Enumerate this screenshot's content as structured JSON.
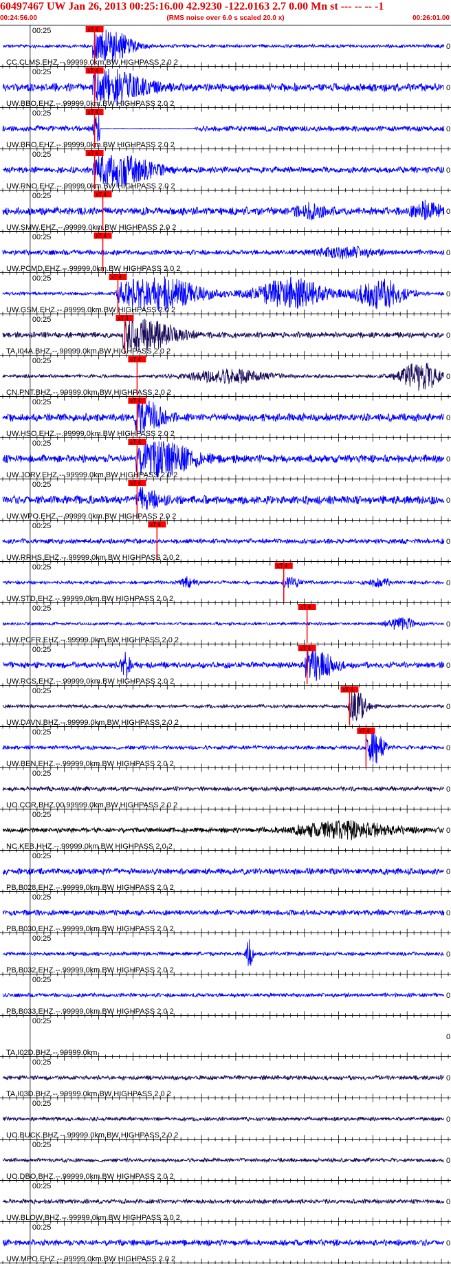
{
  "header": {
    "title": "60497467 UW Jan 26, 2013 00:25:16.00   42.9230 -122.0163  2.7 0.00 Mn st --- -- --  -1",
    "start_time": "00:24:56.00",
    "note": "(RMS noise over 6.0 s scaled 20.0 x)",
    "end_time": "00:26:01.00"
  },
  "chart_data": {
    "type": "line",
    "title": "60497467 UW Jan 26, 2013 00:25:16.00   42.9230 -122.0163  2.7 0.00 Mn st --- -- --  -1",
    "x_start": "00:24:56.00",
    "x_end": "00:26:01.00",
    "x_range_seconds": [
      0,
      65
    ],
    "minute_marker": "00:25",
    "minute_marker_seconds": 4,
    "pick_label": "xT 4",
    "edge_mark": "0",
    "colors": {
      "blue": "#0000ff",
      "navy": "#1a0a5a",
      "black": "#000000",
      "pick": "#ff0000"
    },
    "traces": [
      {
        "label": "CC.CLMS.EHZ.--.99999.0km.BW  HIGHPASS  2.0  2",
        "color": "#0000ff",
        "pick_s": 13.4,
        "noise": 0.12,
        "bursts": [
          [
            15.2,
            2.5,
            1.1
          ]
        ]
      },
      {
        "label": "UW.BBO.EHZ.--.99999.0km.BW  HIGHPASS  2.0  2",
        "color": "#0000ff",
        "pick_s": 13.4,
        "noise": 0.28,
        "bursts": [
          [
            16.0,
            3.5,
            1.0
          ]
        ]
      },
      {
        "label": "UW.BRO.EHZ.--.99999.0km.BW  HIGHPASS  2.0  2",
        "color": "#0000ff",
        "pick_s": 13.4,
        "noise": 0.2,
        "bursts": [
          [
            13.8,
            0.4,
            1.0
          ]
        ],
        "flat": [
          14.2,
          28
        ]
      },
      {
        "label": "UW.RNO.EHZ.--.99999.0km.BW  HIGHPASS  2.0  2",
        "color": "#0000ff",
        "pick_s": 13.4,
        "noise": 0.22,
        "bursts": [
          [
            16.5,
            3.5,
            1.1
          ]
        ]
      },
      {
        "label": "UW.SMW.EHZ.--.99999.0km.BW  HIGHPASS  2.0  2",
        "color": "#0000ff",
        "pick_s": 14.6,
        "noise": 0.28,
        "bursts": [
          [
            62,
            1.5,
            0.5
          ],
          [
            45,
            1.5,
            0.35
          ]
        ]
      },
      {
        "label": "UW.PCMD.EHZ.--.99999.0km.BW  HIGHPASS  2.0  2",
        "color": "#0000ff",
        "pick_s": 14.6,
        "noise": 0.18,
        "bursts": [
          [
            50,
            3,
            0.3
          ]
        ]
      },
      {
        "label": "UW.GSM.EHZ.--.99999.0km.BW  HIGHPASS  2.0  2",
        "color": "#0000ff",
        "pick_s": 16.8,
        "noise": 0.12,
        "bursts": [
          [
            22,
            5,
            1.1
          ],
          [
            42,
            3.5,
            1.0
          ],
          [
            55,
            2.5,
            1.0
          ]
        ]
      },
      {
        "label": "TA.I04A.BHZ.--.99999.0km.BW  HIGHPASS  2.0  2",
        "color": "#1a0a5a",
        "pick_s": 17.8,
        "noise": 0.2,
        "bursts": [
          [
            20,
            4,
            0.95
          ]
        ]
      },
      {
        "label": "CN.PNT.BHZ.--.99999.0km.BW  HIGHPASS  2.0  2",
        "color": "#1a0a5a",
        "pick_s": 19.6,
        "noise": 0.12,
        "bursts": [
          [
            33,
            4,
            0.45
          ],
          [
            61,
            2,
            0.95
          ]
        ]
      },
      {
        "label": "UW.HSO.EHZ.--.99999.0km.BW  HIGHPASS  2.0  2",
        "color": "#0000ff",
        "pick_s": 19.6,
        "noise": 0.28,
        "bursts": [
          [
            20.8,
            1.8,
            1.0
          ]
        ]
      },
      {
        "label": "UW.JORV.EHZ.--.99999.0km.BW  HIGHPASS  2.0  2",
        "color": "#0000ff",
        "pick_s": 19.6,
        "noise": 0.28,
        "bursts": [
          [
            22.5,
            3.5,
            1.1
          ]
        ]
      },
      {
        "label": "UW.WPO.EHZ.--.99999.0km.BW  HIGHPASS  2.0  2",
        "color": "#0000ff",
        "pick_s": 19.6,
        "noise": 0.3,
        "bursts": [
          [
            20,
            2,
            0.6
          ]
        ]
      },
      {
        "label": "UW.RRHS.EHZ.--.99999.0km.BW  HIGHPASS  2.0  2",
        "color": "#0000ff",
        "pick_s": 22.5,
        "noise": 0.18,
        "bursts": []
      },
      {
        "label": "UW.STD.EHZ.--.99999.0km.BW  HIGHPASS  2.0  2",
        "color": "#0000ff",
        "pick_s": 41.0,
        "noise": 0.12,
        "bursts": [
          [
            27,
            0.8,
            0.3
          ],
          [
            42,
            1,
            0.3
          ],
          [
            55,
            1,
            0.3
          ]
        ]
      },
      {
        "label": "UW.PCFR.EHZ.--.99999.0km.BW  HIGHPASS  2.0  2",
        "color": "#0000ff",
        "pick_s": 44.4,
        "noise": 0.1,
        "bursts": [
          [
            58,
            1.5,
            0.4
          ]
        ]
      },
      {
        "label": "UW.RCS.EHZ.--.99999.0km.BW  HIGHPASS  2.0  2",
        "color": "#0000ff",
        "pick_s": 44.4,
        "noise": 0.22,
        "bursts": [
          [
            45.5,
            2,
            0.9
          ],
          [
            18,
            0.6,
            0.8
          ]
        ]
      },
      {
        "label": "UW.DAVN.BHZ.--.99999.0km.BW  HIGHPASS  2.0  2",
        "color": "#1a0a5a",
        "pick_s": 50.6,
        "noise": 0.12,
        "bursts": [
          [
            51.5,
            1.2,
            0.95
          ]
        ]
      },
      {
        "label": "UW.BEN.EHZ.--.99999.0km.BW  HIGHPASS  2.0  2",
        "color": "#0000ff",
        "pick_s": 53.0,
        "noise": 0.14,
        "bursts": [
          [
            54.3,
            0.9,
            1.05
          ]
        ]
      },
      {
        "label": "UO.COR.BHZ.00.99999.0km.BW  HIGHPASS  2.0  2",
        "color": "#1a0a5a",
        "pick_s": null,
        "noise": 0.16,
        "bursts": []
      },
      {
        "label": "NC.KEB.HHZ.--.99999.0km.BW  HIGHPASS  2.0  2",
        "color": "#000000",
        "pick_s": null,
        "noise": 0.18,
        "bursts": [
          [
            50,
            5,
            0.5
          ]
        ]
      },
      {
        "label": "PB.B028.EHZ.--.99999.0km.BW  HIGHPASS  2.0  2",
        "color": "#0000ff",
        "pick_s": null,
        "noise": 0.22,
        "bursts": []
      },
      {
        "label": "PB.B030.EHZ.--.99999.0km.BW  HIGHPASS  2.0  2",
        "color": "#0000ff",
        "pick_s": null,
        "noise": 0.2,
        "bursts": []
      },
      {
        "label": "PB.B032.EHZ.--.99999.0km.BW  HIGHPASS  2.0  2",
        "color": "#0000ff",
        "pick_s": null,
        "noise": 0.14,
        "bursts": [
          [
            36,
            0.35,
            0.85
          ]
        ]
      },
      {
        "label": "PB.B033.EHZ.--.99999.0km.BW  HIGHPASS  2.0  2",
        "color": "#0000ff",
        "pick_s": null,
        "noise": 0.14,
        "bursts": []
      },
      {
        "label": "TA.I02D.BHZ.--.99999.0km",
        "color": "#1a0a5a",
        "pick_s": null,
        "noise": 0.0,
        "bursts": []
      },
      {
        "label": "TA.I03D.BHZ.--.99999.0km.BW  HIGHPASS  2.0  2",
        "color": "#1a0a5a",
        "pick_s": null,
        "noise": 0.16,
        "bursts": []
      },
      {
        "label": "UO.BUCK.BHZ.--.99999.0km.BW  HIGHPASS  2.0  2",
        "color": "#1a0a5a",
        "pick_s": null,
        "noise": 0.14,
        "bursts": []
      },
      {
        "label": "UO.DBO.BHZ.--.99999.0km.BW  HIGHPASS  2.0  2",
        "color": "#1a0a5a",
        "pick_s": null,
        "noise": 0.14,
        "bursts": []
      },
      {
        "label": "UW.BLOW.BHZ.--.99999.0km.BW  HIGHPASS  2.0  2",
        "color": "#1a0a5a",
        "pick_s": null,
        "noise": 0.16,
        "bursts": []
      },
      {
        "label": "UW.MPO.EHZ.--.99999.0km.BW  HIGHPASS  2.0  2",
        "color": "#0000ff",
        "pick_s": null,
        "noise": 0.22,
        "bursts": []
      }
    ]
  }
}
